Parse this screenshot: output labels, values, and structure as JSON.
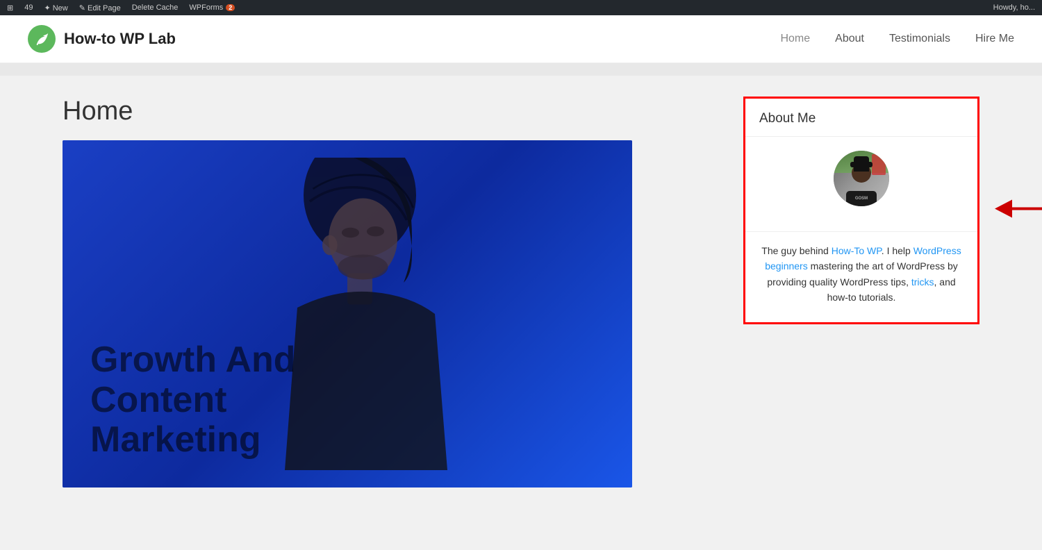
{
  "admin_bar": {
    "items": [
      {
        "label": "49",
        "icon": "wp-icon"
      },
      {
        "label": "New"
      },
      {
        "label": "Edit Page"
      },
      {
        "label": "Delete Cache"
      },
      {
        "label": "WPForms",
        "badge": "2"
      }
    ],
    "right_text": "Howdy, ho..."
  },
  "header": {
    "site_title": "How-to WP Lab",
    "nav": [
      {
        "label": "Home",
        "active": true
      },
      {
        "label": "About"
      },
      {
        "label": "Testimonials"
      },
      {
        "label": "Hire Me"
      }
    ]
  },
  "main": {
    "page_heading": "Home",
    "hero": {
      "line1": "Growth And",
      "line2": "Content",
      "line3": "Marketing"
    }
  },
  "sidebar": {
    "widget_title": "About Me",
    "bio_html": "The guy behind How-To WP. I help WordPress beginners mastering the art of WordPress by providing quality WordPress tips, tricks, and how-to tutorials."
  }
}
